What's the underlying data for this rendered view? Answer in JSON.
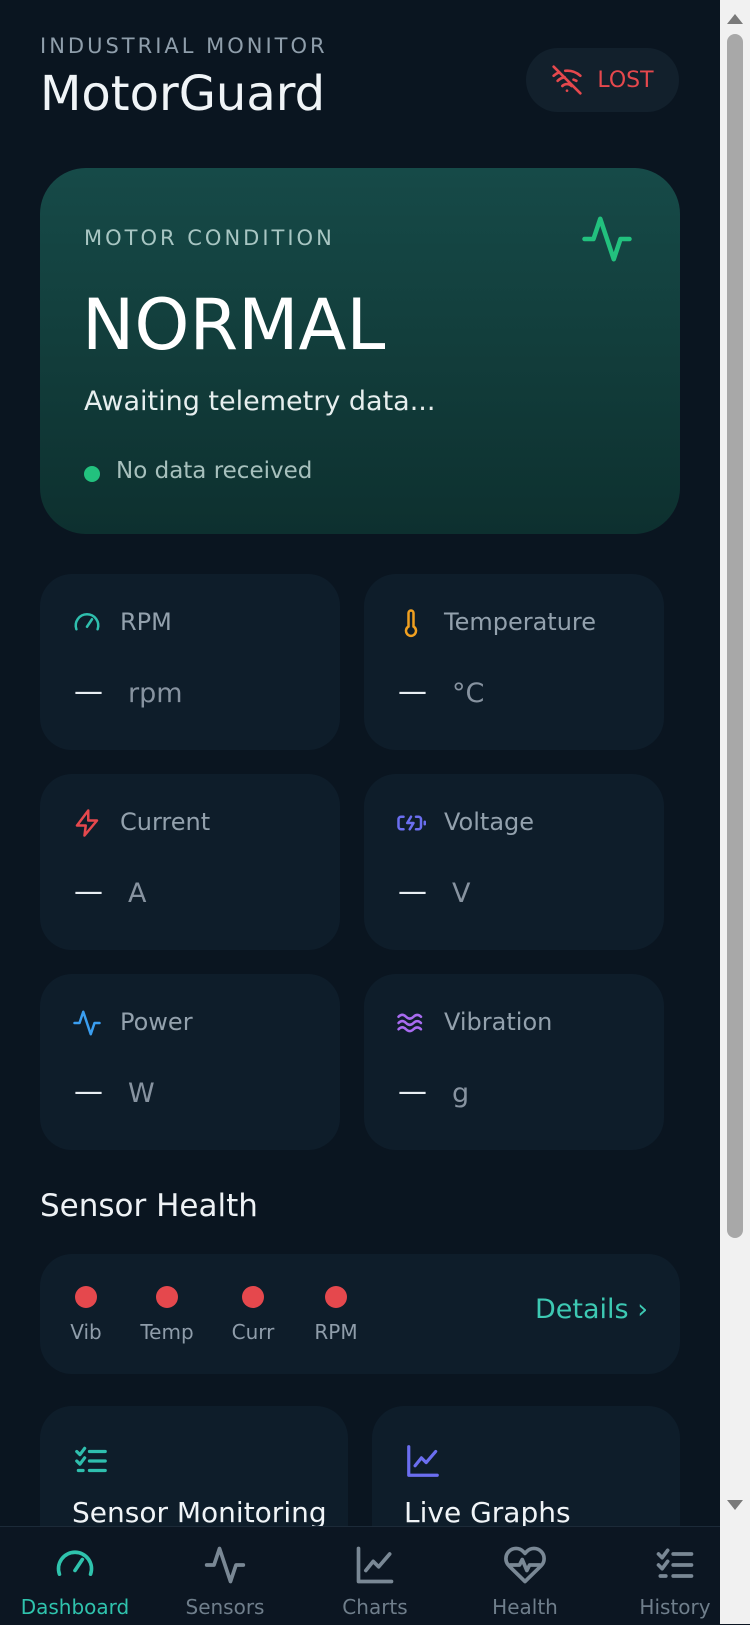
{
  "header": {
    "eyebrow": "INDUSTRIAL MONITOR",
    "title": "MotorGuard",
    "connection": {
      "label": "LOST",
      "icon": "wifi-off-icon",
      "color": "#e5484d"
    }
  },
  "condition": {
    "label": "MOTOR CONDITION",
    "status": "NORMAL",
    "subtitle": "Awaiting telemetry data...",
    "note": "No data received",
    "icon": "activity-icon",
    "accent": "#22c17e"
  },
  "metrics": [
    {
      "label": "RPM",
      "value": "—",
      "unit": "rpm",
      "icon": "gauge-icon",
      "color": "#2fbfae"
    },
    {
      "label": "Temperature",
      "value": "—",
      "unit": "°C",
      "icon": "thermometer-icon",
      "color": "#f0a020"
    },
    {
      "label": "Current",
      "value": "—",
      "unit": "A",
      "icon": "lightning-icon",
      "color": "#e5484d"
    },
    {
      "label": "Voltage",
      "value": "—",
      "unit": "V",
      "icon": "battery-charging-icon",
      "color": "#6b6ef0"
    },
    {
      "label": "Power",
      "value": "—",
      "unit": "W",
      "icon": "activity-icon",
      "color": "#3a9ef0"
    },
    {
      "label": "Vibration",
      "value": "—",
      "unit": "g",
      "icon": "waves-icon",
      "color": "#a86bf0"
    }
  ],
  "sensor_health": {
    "title": "Sensor Health",
    "items": [
      {
        "label": "Vib",
        "color": "#e5484d"
      },
      {
        "label": "Temp",
        "color": "#e5484d"
      },
      {
        "label": "Curr",
        "color": "#e5484d"
      },
      {
        "label": "RPM",
        "color": "#e5484d"
      }
    ],
    "details_label": "Details ›"
  },
  "features": [
    {
      "label": "Sensor Monitoring",
      "icon": "checklist-icon",
      "color": "#2fbfae"
    },
    {
      "label": "Live Graphs",
      "icon": "line-chart-icon",
      "color": "#6b6ef0"
    }
  ],
  "nav": [
    {
      "label": "Dashboard",
      "icon": "gauge-icon",
      "active": true
    },
    {
      "label": "Sensors",
      "icon": "activity-icon",
      "active": false
    },
    {
      "label": "Charts",
      "icon": "line-chart-icon",
      "active": false
    },
    {
      "label": "Health",
      "icon": "heart-pulse-icon",
      "active": false
    },
    {
      "label": "History",
      "icon": "checklist-icon",
      "active": false
    }
  ]
}
